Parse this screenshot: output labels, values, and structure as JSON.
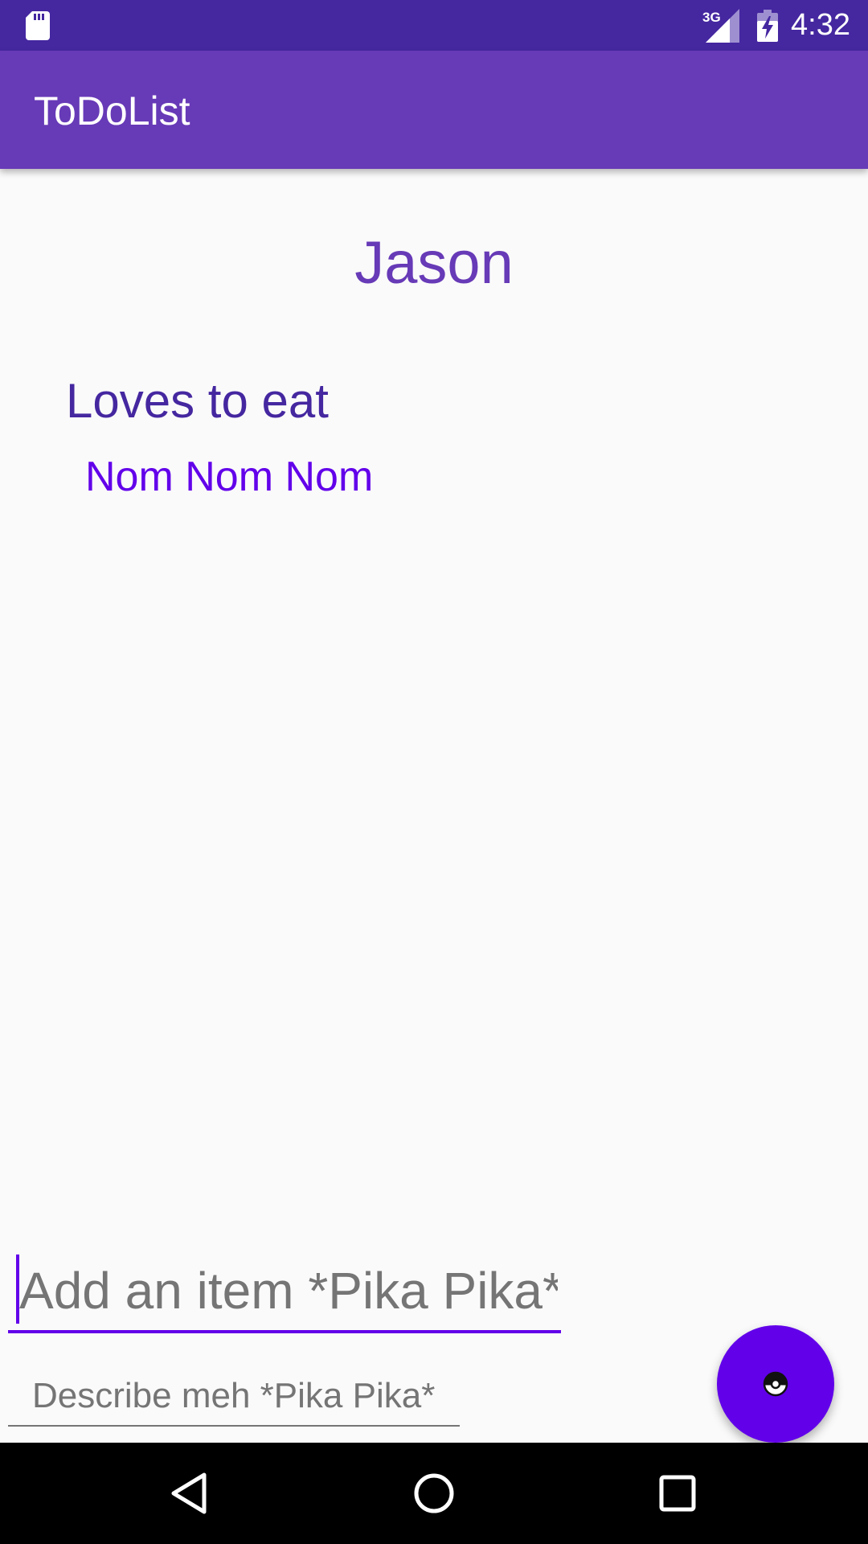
{
  "status_bar": {
    "time": "4:32",
    "network_type": "3G",
    "icons": [
      "sd-card-icon",
      "signal-icon",
      "battery-charging-icon"
    ]
  },
  "app_bar": {
    "title": "ToDoList"
  },
  "content": {
    "name": "Jason",
    "items": [
      {
        "title": "Loves to eat",
        "description": "Nom Nom Nom"
      }
    ]
  },
  "form": {
    "item_input": {
      "value": "",
      "placeholder": "Add an item *Pika Pika*"
    },
    "description_input": {
      "value": "",
      "placeholder": "Describe meh *Pika Pika*"
    }
  },
  "fab": {
    "icon": "pokeball-icon"
  },
  "nav_bar": {
    "icons": [
      "back-icon",
      "home-icon",
      "recents-icon"
    ]
  },
  "colors": {
    "status_bar": "#4527a0",
    "app_bar": "#673ab7",
    "accent": "#6200ea",
    "item_title": "#4527a0",
    "background": "#fafafa"
  }
}
